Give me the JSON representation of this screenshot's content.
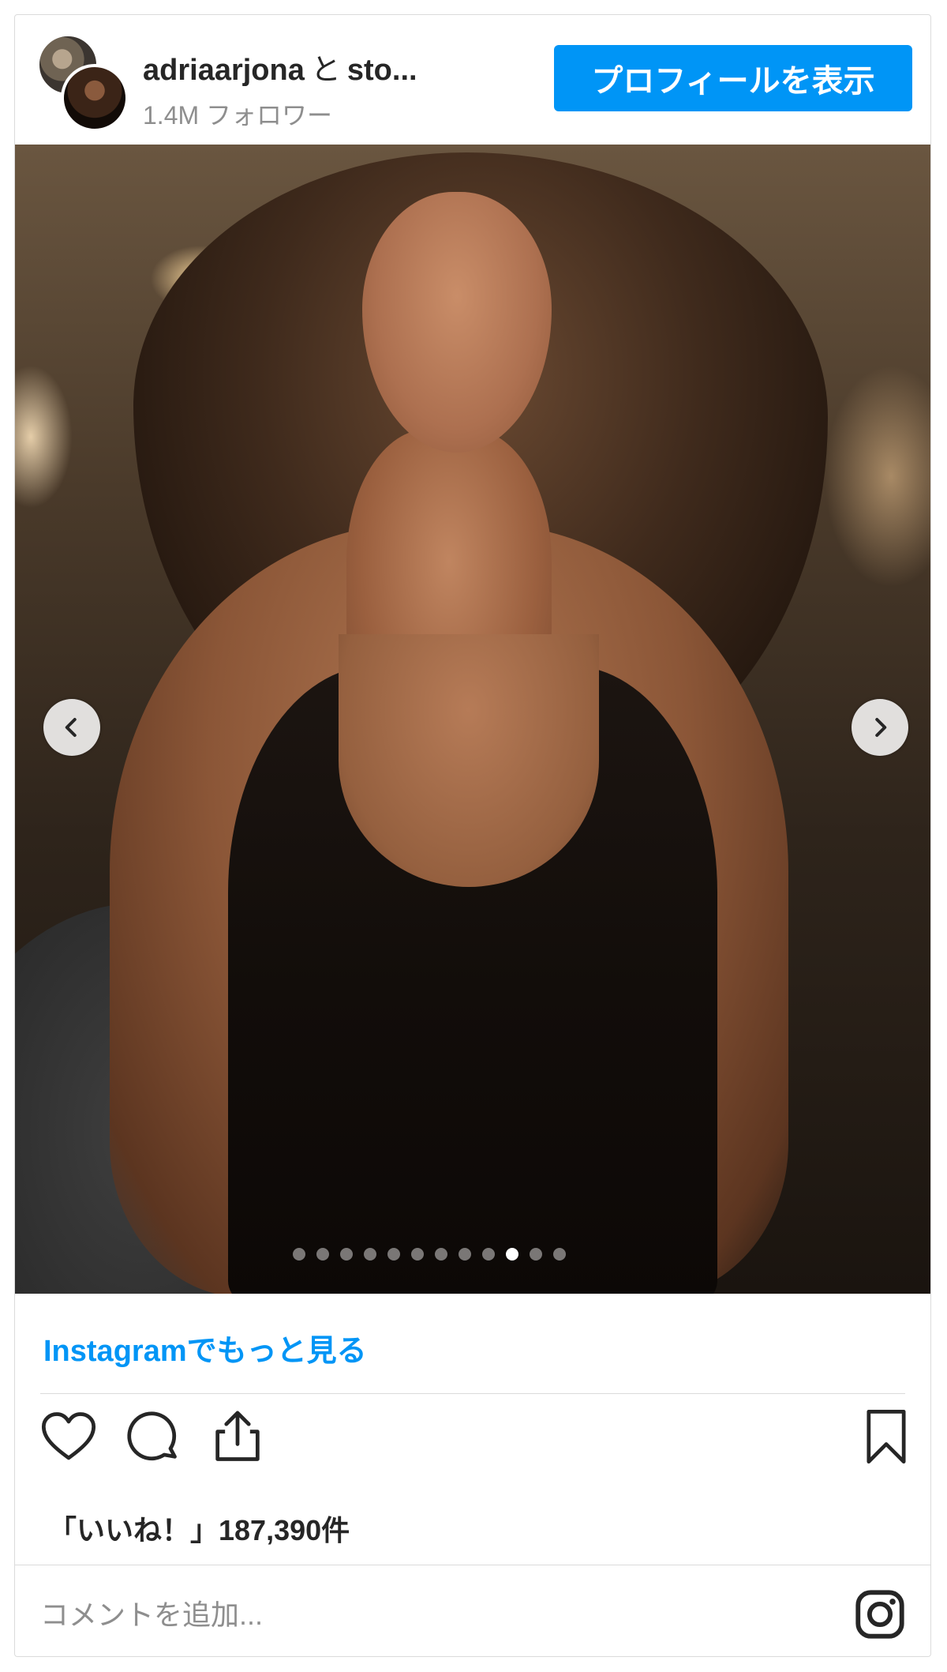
{
  "header": {
    "username": "adriaarjona",
    "conjunction": "と",
    "collaborator": "sto...",
    "followers": "1.4M フォロワー",
    "profile_button": "プロフィールを表示"
  },
  "carousel": {
    "total_slides": 12,
    "active_index": 9
  },
  "more_link": "Instagramでもっと見る",
  "likes": "「いいね！」187,390件",
  "comment": {
    "placeholder": "コメントを追加..."
  },
  "colors": {
    "accent": "#0095f6",
    "text": "#262626",
    "secondary_text": "#8e8e8e",
    "border": "#dbdbdb"
  },
  "icons": [
    "heart-icon",
    "comment-icon",
    "share-icon",
    "bookmark-icon",
    "instagram-icon",
    "chevron-left-icon",
    "chevron-right-icon"
  ]
}
